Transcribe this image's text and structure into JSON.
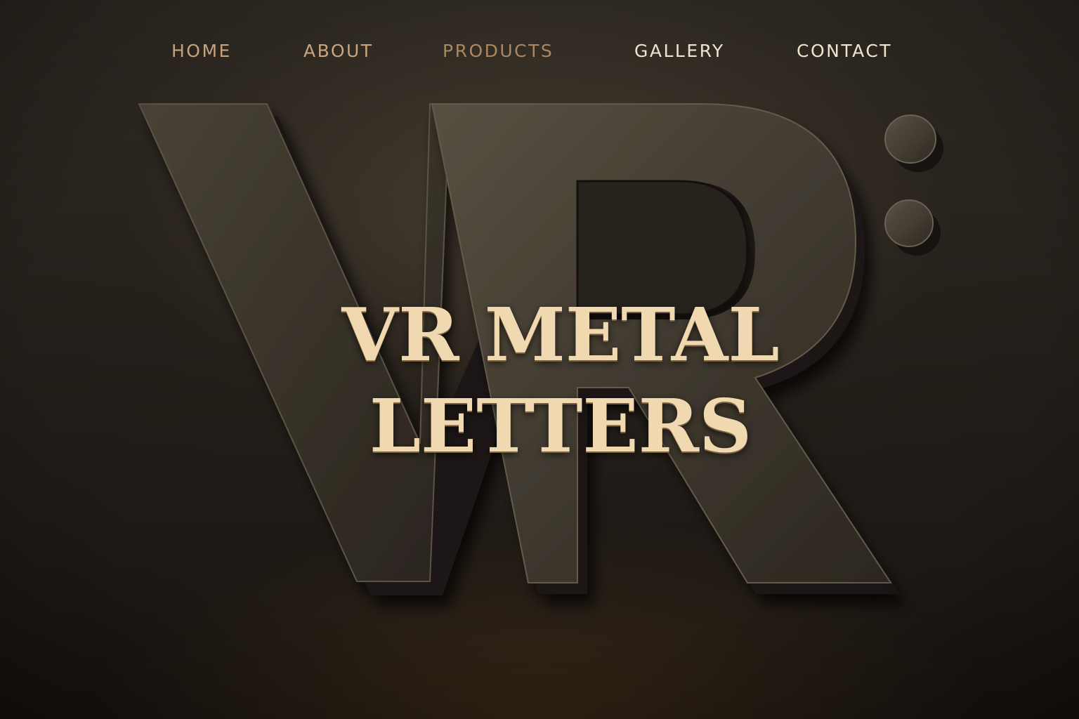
{
  "nav": {
    "items": [
      {
        "label": "HOME"
      },
      {
        "label": "ABOUT"
      },
      {
        "label": "PRODUCTS"
      },
      {
        "label": "GALLERY"
      },
      {
        "label": "CONTACT"
      }
    ]
  },
  "hero": {
    "headline_line1": "VR METAL",
    "headline_line2": "LETTERS",
    "emblem_text": "VR:"
  },
  "colors": {
    "background": "#241f1a",
    "headline": "#f0d9b0",
    "nav_gold": "#c6a27c",
    "nav_light": "#efe3d0",
    "metal": "#3a342b"
  }
}
